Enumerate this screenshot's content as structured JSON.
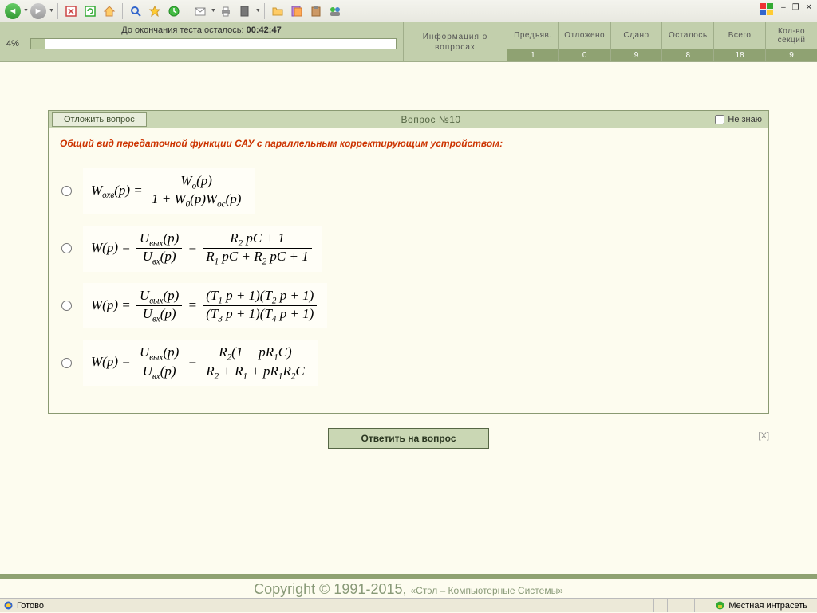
{
  "toolbar": {},
  "wincontrols": {
    "min": "–",
    "max": "❐",
    "close": "✕"
  },
  "header": {
    "timer_label": "До окончания теста осталось: ",
    "timer_value": "00:42:47",
    "progress_pct": "4%",
    "info_label": "Информация о вопросах",
    "cols": [
      {
        "head": "Предъяв.",
        "val": "1"
      },
      {
        "head": "Отложено",
        "val": "0"
      },
      {
        "head": "Сдано",
        "val": "9"
      },
      {
        "head": "Осталось",
        "val": "8"
      },
      {
        "head": "Всего",
        "val": "18"
      }
    ],
    "sections_head": "Кол-во секций",
    "sections_val": "9"
  },
  "question": {
    "postpone": "Отложить вопрос",
    "title": "Вопрос  №10",
    "dontknow": "Не знаю",
    "prompt": "Общий вид передаточной функции САУ с параллельным корректирующим устройством:",
    "answer_btn": "Ответить на вопрос",
    "close_x": "[X]"
  },
  "footer": {
    "copyright_main": "Copyright  © 1991-2015, ",
    "copyright_sub": "«Стэл – Компьютерные Системы»"
  },
  "statusbar": {
    "ready": "Готово",
    "zone": "Местная интрасеть"
  }
}
